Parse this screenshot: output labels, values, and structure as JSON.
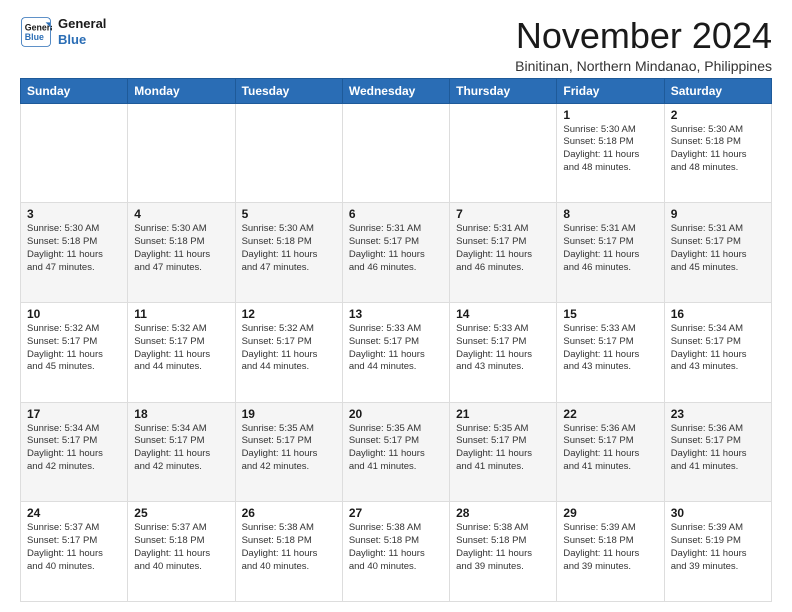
{
  "logo": {
    "line1": "General",
    "line2": "Blue"
  },
  "title": "November 2024",
  "location": "Binitinan, Northern Mindanao, Philippines",
  "days_of_week": [
    "Sunday",
    "Monday",
    "Tuesday",
    "Wednesday",
    "Thursday",
    "Friday",
    "Saturday"
  ],
  "weeks": [
    [
      {
        "day": "",
        "info": ""
      },
      {
        "day": "",
        "info": ""
      },
      {
        "day": "",
        "info": ""
      },
      {
        "day": "",
        "info": ""
      },
      {
        "day": "",
        "info": ""
      },
      {
        "day": "1",
        "info": "Sunrise: 5:30 AM\nSunset: 5:18 PM\nDaylight: 11 hours\nand 48 minutes."
      },
      {
        "day": "2",
        "info": "Sunrise: 5:30 AM\nSunset: 5:18 PM\nDaylight: 11 hours\nand 48 minutes."
      }
    ],
    [
      {
        "day": "3",
        "info": "Sunrise: 5:30 AM\nSunset: 5:18 PM\nDaylight: 11 hours\nand 47 minutes."
      },
      {
        "day": "4",
        "info": "Sunrise: 5:30 AM\nSunset: 5:18 PM\nDaylight: 11 hours\nand 47 minutes."
      },
      {
        "day": "5",
        "info": "Sunrise: 5:30 AM\nSunset: 5:18 PM\nDaylight: 11 hours\nand 47 minutes."
      },
      {
        "day": "6",
        "info": "Sunrise: 5:31 AM\nSunset: 5:17 PM\nDaylight: 11 hours\nand 46 minutes."
      },
      {
        "day": "7",
        "info": "Sunrise: 5:31 AM\nSunset: 5:17 PM\nDaylight: 11 hours\nand 46 minutes."
      },
      {
        "day": "8",
        "info": "Sunrise: 5:31 AM\nSunset: 5:17 PM\nDaylight: 11 hours\nand 46 minutes."
      },
      {
        "day": "9",
        "info": "Sunrise: 5:31 AM\nSunset: 5:17 PM\nDaylight: 11 hours\nand 45 minutes."
      }
    ],
    [
      {
        "day": "10",
        "info": "Sunrise: 5:32 AM\nSunset: 5:17 PM\nDaylight: 11 hours\nand 45 minutes."
      },
      {
        "day": "11",
        "info": "Sunrise: 5:32 AM\nSunset: 5:17 PM\nDaylight: 11 hours\nand 44 minutes."
      },
      {
        "day": "12",
        "info": "Sunrise: 5:32 AM\nSunset: 5:17 PM\nDaylight: 11 hours\nand 44 minutes."
      },
      {
        "day": "13",
        "info": "Sunrise: 5:33 AM\nSunset: 5:17 PM\nDaylight: 11 hours\nand 44 minutes."
      },
      {
        "day": "14",
        "info": "Sunrise: 5:33 AM\nSunset: 5:17 PM\nDaylight: 11 hours\nand 43 minutes."
      },
      {
        "day": "15",
        "info": "Sunrise: 5:33 AM\nSunset: 5:17 PM\nDaylight: 11 hours\nand 43 minutes."
      },
      {
        "day": "16",
        "info": "Sunrise: 5:34 AM\nSunset: 5:17 PM\nDaylight: 11 hours\nand 43 minutes."
      }
    ],
    [
      {
        "day": "17",
        "info": "Sunrise: 5:34 AM\nSunset: 5:17 PM\nDaylight: 11 hours\nand 42 minutes."
      },
      {
        "day": "18",
        "info": "Sunrise: 5:34 AM\nSunset: 5:17 PM\nDaylight: 11 hours\nand 42 minutes."
      },
      {
        "day": "19",
        "info": "Sunrise: 5:35 AM\nSunset: 5:17 PM\nDaylight: 11 hours\nand 42 minutes."
      },
      {
        "day": "20",
        "info": "Sunrise: 5:35 AM\nSunset: 5:17 PM\nDaylight: 11 hours\nand 41 minutes."
      },
      {
        "day": "21",
        "info": "Sunrise: 5:35 AM\nSunset: 5:17 PM\nDaylight: 11 hours\nand 41 minutes."
      },
      {
        "day": "22",
        "info": "Sunrise: 5:36 AM\nSunset: 5:17 PM\nDaylight: 11 hours\nand 41 minutes."
      },
      {
        "day": "23",
        "info": "Sunrise: 5:36 AM\nSunset: 5:17 PM\nDaylight: 11 hours\nand 41 minutes."
      }
    ],
    [
      {
        "day": "24",
        "info": "Sunrise: 5:37 AM\nSunset: 5:17 PM\nDaylight: 11 hours\nand 40 minutes."
      },
      {
        "day": "25",
        "info": "Sunrise: 5:37 AM\nSunset: 5:18 PM\nDaylight: 11 hours\nand 40 minutes."
      },
      {
        "day": "26",
        "info": "Sunrise: 5:38 AM\nSunset: 5:18 PM\nDaylight: 11 hours\nand 40 minutes."
      },
      {
        "day": "27",
        "info": "Sunrise: 5:38 AM\nSunset: 5:18 PM\nDaylight: 11 hours\nand 40 minutes."
      },
      {
        "day": "28",
        "info": "Sunrise: 5:38 AM\nSunset: 5:18 PM\nDaylight: 11 hours\nand 39 minutes."
      },
      {
        "day": "29",
        "info": "Sunrise: 5:39 AM\nSunset: 5:18 PM\nDaylight: 11 hours\nand 39 minutes."
      },
      {
        "day": "30",
        "info": "Sunrise: 5:39 AM\nSunset: 5:19 PM\nDaylight: 11 hours\nand 39 minutes."
      }
    ]
  ]
}
